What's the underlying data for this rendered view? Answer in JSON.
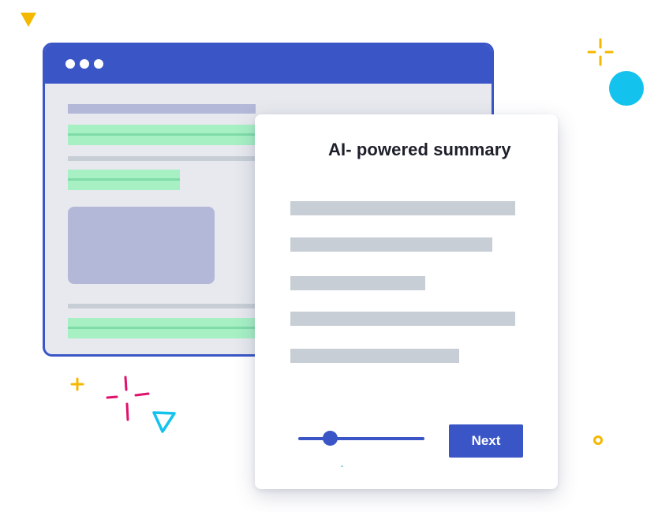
{
  "card": {
    "title": "AI- powered summary",
    "next_label": "Next",
    "slider_value": 0.25
  },
  "colors": {
    "accent": "#3a55c6",
    "highlight_green": "#a6f0c4",
    "text_line_gray": "#c7ced6",
    "image_placeholder": "#b3b7d8",
    "sparkle_yellow": "#f5b800",
    "sparkle_pink": "#e0116a",
    "sparkle_cyan": "#13c3ee"
  },
  "icons": {
    "window_controls": "three-dots-icon",
    "decorations": [
      "triangle-icon",
      "sparkle-icon",
      "circle-icon",
      "plus-icon",
      "ring-icon"
    ]
  }
}
